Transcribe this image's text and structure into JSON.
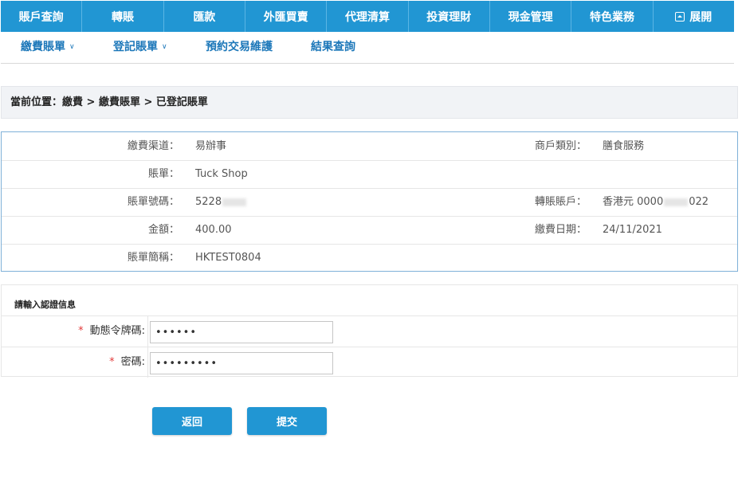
{
  "topnav": {
    "items": [
      "賬戶查詢",
      "轉賬",
      "匯款",
      "外匯買賣",
      "代理清算",
      "投資理財",
      "現金管理",
      "特色業務",
      "展開"
    ]
  },
  "subnav": {
    "items": [
      "繳費賬單",
      "登記賬單",
      "預約交易維護",
      "結果查詢"
    ]
  },
  "breadcrumb": {
    "text": "當前位置：繳費 > 繳費賬單 > 已登記賬單"
  },
  "info": {
    "channel_label": "繳費渠道：",
    "channel_value": "易辦事",
    "merchant_type_label": "商戶類別：",
    "merchant_type_value": "膳食服務",
    "bill_label": "賬單：",
    "bill_value": "Tuck Shop",
    "bill_no_label": "賬單號碼：",
    "bill_no_prefix": "5228",
    "transfer_account_label": "轉賬賬戶：",
    "transfer_account_prefix": "香港元 0000",
    "transfer_account_suffix": "022",
    "amount_label": "金額：",
    "amount_value": "400.00",
    "pay_date_label": "繳費日期：",
    "pay_date_value": "24/11/2021",
    "bill_abbr_label": "賬單簡稱：",
    "bill_abbr_value": "HKTEST0804"
  },
  "auth": {
    "title": "請輸入認證信息",
    "required_mark": "*",
    "token_label": "動態令牌碼:",
    "token_value": "••••••",
    "password_label": "密碼:",
    "password_value": "•••••••••"
  },
  "buttons": {
    "back": "返回",
    "submit": "提交"
  }
}
